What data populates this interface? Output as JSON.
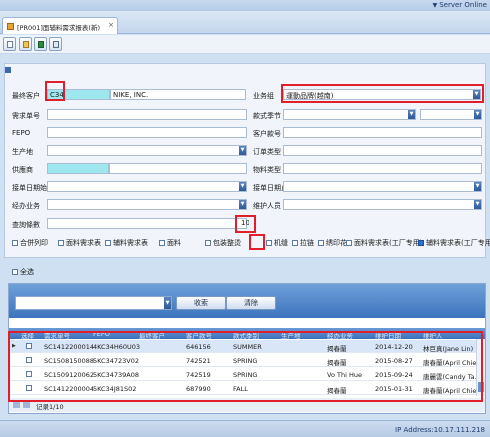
{
  "topbar": {
    "server_label": "Server Online"
  },
  "tab": {
    "title": "[PR001]面辅料需求报表(新)",
    "close": "×"
  },
  "form": {
    "customer": {
      "label": "最终客户",
      "code": "C34",
      "name": "NIKE, INC."
    },
    "business_group": {
      "label": "业务组",
      "value": "運動品牌(越南)"
    },
    "demand_no": {
      "label": "需求单号"
    },
    "season": {
      "label": "款式季节"
    },
    "fepo": {
      "label": "FEPO"
    },
    "customer_no": {
      "label": "客户款号"
    },
    "production_site": {
      "label": "生产地"
    },
    "order_type": {
      "label": "订单类型"
    },
    "supplier": {
      "label": "供應商"
    },
    "material_type": {
      "label": "物料类型"
    },
    "order_date_start": {
      "label": "接单日期始"
    },
    "order_date_end": {
      "label": "接单日期止"
    },
    "business": {
      "label": "经办业务"
    },
    "maintainer": {
      "label": "维护人员"
    },
    "query_rows": {
      "label": "查詢條數",
      "value": "10"
    }
  },
  "checkboxes": [
    {
      "label": "合併列印",
      "checked": false
    },
    {
      "label": "面料需求表",
      "checked": false
    },
    {
      "label": "辅料需求表",
      "checked": false
    },
    {
      "label": "面料",
      "checked": false
    },
    {
      "label": "包装整烫",
      "checked": false
    },
    {
      "label": "机缝",
      "checked": false
    },
    {
      "label": "拉链",
      "checked": false
    },
    {
      "label": "绣印花",
      "checked": false
    },
    {
      "label": "面料需求表(工厂专用)",
      "checked": false
    },
    {
      "label": "辅料需求表(工厂专用)",
      "checked": true
    }
  ],
  "select_all": {
    "label": "全选"
  },
  "results": {
    "search_label": "收索",
    "clear_label": "清除",
    "columns": [
      "选择",
      "需求单号",
      "FEPO",
      "最终客户",
      "客户款号",
      "款式季别",
      "生产地",
      "经办业务",
      "维护日期",
      "维护人"
    ],
    "rows": [
      {
        "demand_no": "SC1412200014",
        "fepo": "4KC34H60U03",
        "customer": "",
        "customer_no": "646156",
        "season": "SUMMER",
        "site": "",
        "business": "揭春蘭",
        "date": "2014-12-20",
        "maintainer": "林巨真(Jane Lin)"
      },
      {
        "demand_no": "SC1508150088",
        "fepo": "5KC34723V02",
        "customer": "",
        "customer_no": "742521",
        "season": "SPRING",
        "site": "",
        "business": "揭春蘭",
        "date": "2015-08-27",
        "maintainer": "唐春蘭(April Chie..."
      },
      {
        "demand_no": "SC1509120062",
        "fepo": "5KC34739A08",
        "customer": "",
        "customer_no": "742519",
        "season": "SPRING",
        "site": "",
        "business": "Vo Thi Hue",
        "date": "2015-09-24",
        "maintainer": "唐麗雲(Candy Ta..."
      },
      {
        "demand_no": "SC1412200004",
        "fepo": "5KC34J81S02",
        "customer": "",
        "customer_no": "687990",
        "season": "FALL",
        "site": "",
        "business": "揭春蘭",
        "date": "2015-01-31",
        "maintainer": "唐春蘭(April Chie..."
      }
    ],
    "pager_text": "记录1/10"
  },
  "status": {
    "ip": "IP Address:10.17.111.218"
  },
  "colors": {
    "accent": "#3b73bd",
    "highlight": "#e01f2b",
    "cyan": "#9fe7ef"
  }
}
